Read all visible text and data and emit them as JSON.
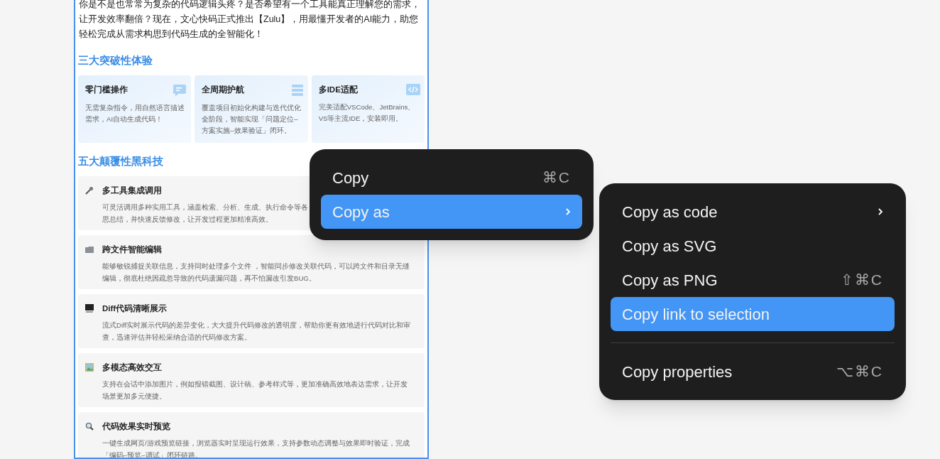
{
  "document": {
    "intro": "你是不是也常常为复杂的代码逻辑头疼？是否希望有一个工具能真正理解您的需求，让开发效率翻倍？现在，文心快码正式推出【Zulu】，用最懂开发者的AI能力，助您轻松完成从需求构思到代码生成的全智能化！",
    "sections": [
      {
        "title": "三大突破性体验",
        "kind": "cards",
        "items": [
          {
            "title": "零门槛操作",
            "description": "无需复杂指令，用自然语言描述需求，AI自动生成代码！"
          },
          {
            "title": "全周期护航",
            "description": "覆盖项目初始化构建与迭代优化全阶段，智能实现「问题定位–方案实施–效果验证」闭环。"
          },
          {
            "title": "多IDE适配",
            "description": "完美适配VSCode、JetBrains、VS等主流IDE，安装即用。"
          }
        ]
      },
      {
        "title": "五大颠覆性黑科技",
        "kind": "list",
        "items": [
          {
            "title": "多工具集成调用",
            "lines": [
              "可灵活调用多种实用工具，涵盖检索、分析、生成、执行命令等各",
              "思总结，并快速反馈修改，让开发过程更加精准高效。"
            ]
          },
          {
            "title": "跨文件智能编辑",
            "lines": [
              "能够敏锐捕捉关联信息，支持同时处理多个文件 ，智能同步修改关联代码，可以跨文件和目录无缝编辑，彻底杜绝因疏忽导致的代码遗漏问题，再不怕漏改引发BUG。"
            ]
          },
          {
            "title": "Diff代码清晰展示",
            "lines": [
              "流式Diff实时展示代码的差异变化，大大提升代码修改的透明度，帮助你更有效地进行代码对比和审查，迅速评估并轻松采纳合适的代码修改方案。"
            ]
          },
          {
            "title": "多模态高效交互",
            "lines": [
              "支持在会话中添加图片，例如报错截图、设计稿、参考样式等，更加准确高效地表达需求，让开发场景更加多元便捷。"
            ]
          },
          {
            "title": "代码效果实时预览",
            "lines": [
              "一键生成网页/游戏预览链接，浏览器实时呈现运行效果，支持参数动态调整与效果即时验证，完成「编码–预览–调试」闭环链路。"
            ]
          }
        ]
      }
    ]
  },
  "context_menu": {
    "items": [
      {
        "kind": "item",
        "label": "Copy",
        "shortcut": "⌘C",
        "submenu": false,
        "selected": false
      },
      {
        "kind": "item",
        "label": "Copy as",
        "submenu": true,
        "selected": true
      }
    ]
  },
  "submenu": {
    "items": [
      {
        "kind": "item",
        "label": "Copy as code",
        "submenu": true,
        "selected": false
      },
      {
        "kind": "item",
        "label": "Copy as SVG",
        "submenu": false,
        "selected": false
      },
      {
        "kind": "item",
        "label": "Copy as PNG",
        "shortcut": "⇧⌘C",
        "submenu": false,
        "selected": false
      },
      {
        "kind": "item",
        "label": "Copy link to selection",
        "submenu": false,
        "selected": true
      },
      {
        "kind": "separator"
      },
      {
        "kind": "item",
        "label": "Copy properties",
        "shortcut": "⌥⌘C",
        "submenu": false,
        "selected": false
      }
    ]
  }
}
